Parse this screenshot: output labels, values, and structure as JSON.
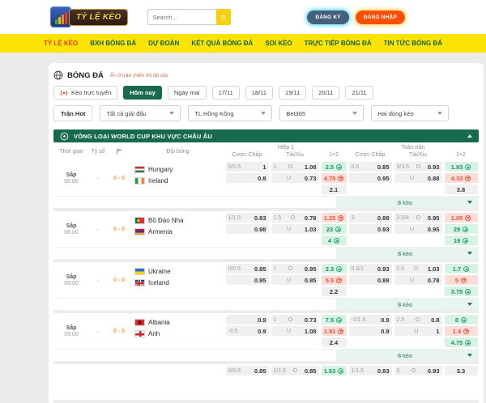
{
  "header": {
    "logo_title": "TỶ LỆ KÈO",
    "search_placeholder": "Search...",
    "register": "ĐĂNG KÝ",
    "login": "ĐĂNG NHẬP"
  },
  "nav": {
    "items": [
      {
        "label": "TỶ LỆ KÈO",
        "active": true
      },
      {
        "label": "BXH BÓNG ĐÁ",
        "active": false
      },
      {
        "label": "DỰ ĐOÁN",
        "active": false
      },
      {
        "label": "KẾT QUẢ BÓNG ĐÁ",
        "active": false
      },
      {
        "label": "SOI KÈO",
        "active": false
      },
      {
        "label": "TRỰC TIẾP BÓNG ĐÁ",
        "active": false
      },
      {
        "label": "TIN TỨC BÓNG ĐÁ",
        "active": false
      }
    ]
  },
  "section": {
    "title": "BÓNG ĐÁ",
    "subtitle": "Ẩn 0 trận (hiển thị tất cả)"
  },
  "tabs": {
    "live": "Kèo trực tuyến",
    "items": [
      "Hôm nay",
      "Ngày mai",
      "17/11",
      "18/11",
      "19/11",
      "20/11",
      "21/11"
    ],
    "active_index": 0
  },
  "filters": {
    "hot": "Trận Hot",
    "selects": [
      "Tất cả giải đấu",
      "TL Hồng Kông",
      "Bet365",
      "Hai dòng kèo"
    ]
  },
  "league": {
    "title": "VÒNG LOẠI WORLD CUP KHU VỰC CHÂU ÂU"
  },
  "table": {
    "col_time": "Thời gian",
    "col_score": "Tỷ số",
    "col_team": "Đội bóng",
    "group_h1": "Hiệp 1",
    "group_ft": "Toàn trận",
    "col_handicap": "Cược Chấp",
    "col_ou": "Tài/Xỉu",
    "col_1x2": "1×2"
  },
  "colors": {
    "accent_green": "#186a4e",
    "nav_yellow": "#fae307",
    "active_red": "#e2401a",
    "login_orange": "#fb4f08",
    "register_slate": "#44607a",
    "odds_up_bg": "#d8f2e4",
    "odds_down_bg": "#fbded7",
    "corner_orange": "#f0a13c"
  },
  "matches": [
    {
      "time_label": "Sắp",
      "time": "06:00",
      "score": "-",
      "corner": "0 - 0",
      "teams": [
        {
          "name": "Hungary",
          "flag": "hu"
        },
        {
          "name": "Ireland",
          "flag": "ie"
        }
      ],
      "h1": {
        "cc": [
          {
            "line": "0/0.5",
            "odds": "1"
          },
          {
            "line": "",
            "odds": "0.8"
          }
        ],
        "ou": [
          {
            "line": "1",
            "side": "O",
            "odds": "1.08"
          },
          {
            "line": "",
            "side": "U",
            "odds": "0.73"
          }
        ],
        "x2": [
          {
            "v": "2.5",
            "t": "up"
          },
          {
            "v": "4.75",
            "t": "down"
          },
          {
            "v": "2.1",
            "t": ""
          }
        ]
      },
      "ft": {
        "cc": [
          {
            "line": "0.5",
            "odds": "0.85"
          },
          {
            "line": "",
            "odds": "0.95"
          }
        ],
        "ou": [
          {
            "line": "3/3.5",
            "side": "O",
            "odds": "0.93"
          },
          {
            "line": "",
            "side": "U",
            "odds": "0.88"
          }
        ],
        "x2": [
          {
            "v": "1.93",
            "t": "up"
          },
          {
            "v": "4.33",
            "t": "down"
          },
          {
            "v": "3.8",
            "t": ""
          }
        ]
      },
      "more": "8 kèo"
    },
    {
      "time_label": "Sắp",
      "time": "06:00",
      "score": "-",
      "corner": "0 - 0",
      "teams": [
        {
          "name": "Bồ Đào Nha",
          "flag": "pt"
        },
        {
          "name": "Armenia",
          "flag": "am"
        }
      ],
      "h1": {
        "cc": [
          {
            "line": "1/1.5",
            "odds": "0.83"
          },
          {
            "line": "",
            "odds": "0.98"
          }
        ],
        "ou": [
          {
            "line": "1.5",
            "side": "O",
            "odds": "0.78"
          },
          {
            "line": "",
            "side": "U",
            "odds": "1.03"
          }
        ],
        "x2": [
          {
            "v": "1.25",
            "t": "down"
          },
          {
            "v": "23",
            "t": "up"
          },
          {
            "v": "4",
            "t": "up"
          }
        ]
      },
      "ft": {
        "cc": [
          {
            "line": "3",
            "odds": "0.88"
          },
          {
            "line": "",
            "odds": "0.93"
          }
        ],
        "ou": [
          {
            "line": "3.5/4",
            "side": "O",
            "odds": "0.95"
          },
          {
            "line": "",
            "side": "U",
            "odds": "0.95"
          }
        ],
        "x2": [
          {
            "v": "1.05",
            "t": "down"
          },
          {
            "v": "29",
            "t": "up"
          },
          {
            "v": "19",
            "t": "up"
          }
        ]
      },
      "more": "8 kèo"
    },
    {
      "time_label": "Sắp",
      "time": "09:00",
      "score": "-",
      "corner": "0 - 0",
      "teams": [
        {
          "name": "Ukraine",
          "flag": "ua"
        },
        {
          "name": "Iceland",
          "flag": "is"
        }
      ],
      "h1": {
        "cc": [
          {
            "line": "0/0.5",
            "odds": "0.85"
          },
          {
            "line": "",
            "odds": "0.95"
          }
        ],
        "ou": [
          {
            "line": "1",
            "side": "O",
            "odds": "0.95"
          },
          {
            "line": "",
            "side": "U",
            "odds": "0.85"
          }
        ],
        "x2": [
          {
            "v": "2.3",
            "t": "up"
          },
          {
            "v": "5.5",
            "t": "down"
          },
          {
            "v": "2.2",
            "t": ""
          }
        ]
      },
      "ft": {
        "cc": [
          {
            "line": "0.5/1",
            "odds": "0.93"
          },
          {
            "line": "",
            "odds": "0.88"
          }
        ],
        "ou": [
          {
            "line": "2.5",
            "side": "O",
            "odds": "1.03"
          },
          {
            "line": "",
            "side": "U",
            "odds": "0.78"
          }
        ],
        "x2": [
          {
            "v": "1.7",
            "t": "up"
          },
          {
            "v": "5",
            "t": "down"
          },
          {
            "v": "3.75",
            "t": "up"
          }
        ]
      },
      "more": "8 kèo"
    },
    {
      "time_label": "Sắp",
      "time": "09:00",
      "score": "-",
      "corner": "0 - 0",
      "teams": [
        {
          "name": "Albania",
          "flag": "al"
        },
        {
          "name": "Anh",
          "flag": "en"
        }
      ],
      "h1": {
        "cc": [
          {
            "line": "",
            "odds": "0.9"
          },
          {
            "line": "-0.5",
            "odds": "0.9"
          }
        ],
        "ou": [
          {
            "line": "1",
            "side": "O",
            "odds": "0.73"
          },
          {
            "line": "",
            "side": "U",
            "odds": "1.08"
          }
        ],
        "x2": [
          {
            "v": "7.5",
            "t": "up"
          },
          {
            "v": "1.91",
            "t": "down"
          },
          {
            "v": "2.4",
            "t": ""
          }
        ]
      },
      "ft": {
        "cc": [
          {
            "line": "-1/1.5",
            "odds": "0.9"
          },
          {
            "line": "",
            "odds": "0.9"
          }
        ],
        "ou": [
          {
            "line": "2.5",
            "side": "O",
            "odds": "0.8"
          },
          {
            "line": "",
            "side": "U",
            "odds": "1"
          }
        ],
        "x2": [
          {
            "v": "8",
            "t": "up"
          },
          {
            "v": "1.4",
            "t": "down"
          },
          {
            "v": "4.75",
            "t": "up"
          }
        ]
      },
      "more": "8 kèo"
    },
    {
      "time_label": "",
      "time": "",
      "score": "",
      "corner": "",
      "teams": [
        {
          "name": "",
          "flag": ""
        },
        {
          "name": "",
          "flag": ""
        }
      ],
      "h1": {
        "cc": [
          {
            "line": "0/0.5",
            "odds": "0.85"
          }
        ],
        "ou": [
          {
            "line": "1/1.5",
            "side": "O",
            "odds": "0.85"
          }
        ],
        "x2": [
          {
            "v": "1.63",
            "t": "up"
          }
        ]
      },
      "ft": {
        "cc": [
          {
            "line": "1/1.5",
            "odds": "0.83"
          }
        ],
        "ou": [
          {
            "line": "3",
            "side": "O",
            "odds": "0.93"
          }
        ],
        "x2": [
          {
            "v": "3.3",
            "t": ""
          }
        ]
      },
      "more": ""
    }
  ]
}
